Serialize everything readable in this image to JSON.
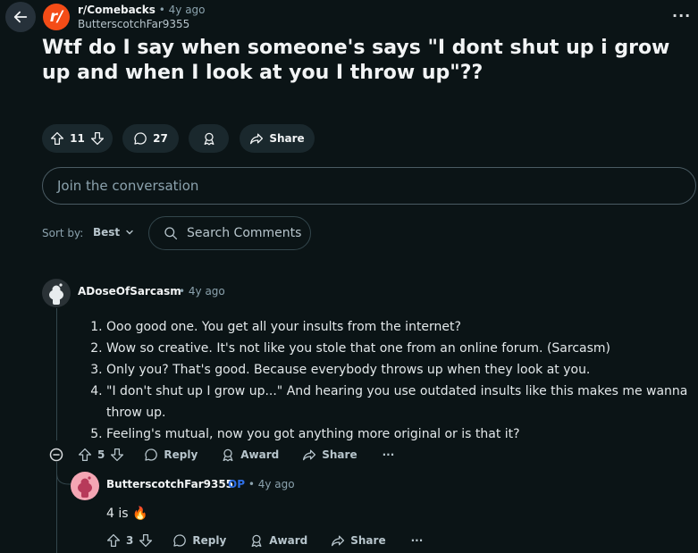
{
  "post": {
    "subreddit": "r/Comebacks",
    "time_sep": "•",
    "time": "4y ago",
    "author": "ButterscotchFar9355",
    "title": "Wtf do I say when someone's says \"I dont shut up i grow up and when I look at you I throw up\"??",
    "votes": "11",
    "comments": "27",
    "share_label": "Share"
  },
  "join_placeholder": "Join the conversation",
  "sort": {
    "label": "Sort by:",
    "value": "Best"
  },
  "search": {
    "placeholder": "Search Comments"
  },
  "comments": [
    {
      "author": "ADoseOfSarcasm",
      "time": "• 4y ago",
      "items": [
        "Ooo good one. You get all your insults from the internet?",
        "Wow so creative. It's not like you stole that one from an online forum. (Sarcasm)",
        "Only you? That's good. Because everybody throws up when they look at you.",
        "\"I don't shut up I grow up...\" And hearing you use outdated insults like this makes me wanna throw up.",
        "Feeling's mutual, now you got anything more original or is that it?"
      ],
      "votes": "5",
      "reply_label": "Reply",
      "award_label": "Award",
      "share_label": "Share",
      "more": "···"
    },
    {
      "author": "ButterscotchFar9355",
      "op_badge": "OP",
      "time": "• 4y ago",
      "text": "4 is 🔥",
      "votes": "3",
      "reply_label": "Reply",
      "award_label": "Award",
      "share_label": "Share",
      "more": "···"
    }
  ],
  "colors": {
    "background": "#0b1416",
    "pill": "#1a282d",
    "brand": "#f44c17",
    "op": "#2e6fe6"
  }
}
